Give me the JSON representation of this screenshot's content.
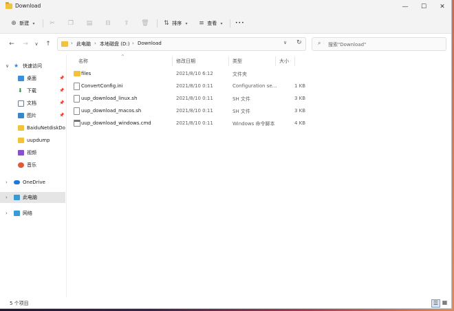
{
  "window": {
    "title": "Download"
  },
  "titlebar": {
    "minimize": "—",
    "maximize": "☐",
    "close": "✕"
  },
  "toolbar": {
    "new_label": "新建",
    "sort_label": "排序",
    "view_label": "查看",
    "more_label": "•••",
    "icons": [
      "cut-icon",
      "copy-icon",
      "paste-icon",
      "rename-icon",
      "share-icon",
      "delete-icon"
    ]
  },
  "address": {
    "crumbs": [
      "此电脑",
      "本地磁盘 (D:)",
      "Download"
    ],
    "search_placeholder": "搜索\"Download\""
  },
  "sidebar": {
    "items": [
      {
        "label": "快速访问",
        "icon": "star-icon",
        "color": "#3b7dd8"
      },
      {
        "label": "桌面",
        "icon": "desktop-icon",
        "color": "#3b8fd8"
      },
      {
        "label": "下载",
        "icon": "download-icon",
        "color": "#2a8a4a"
      },
      {
        "label": "文档",
        "icon": "document-icon",
        "color": "#6b7b8c"
      },
      {
        "label": "图片",
        "icon": "pictures-icon",
        "color": "#3a86c8"
      },
      {
        "label": "BaiduNetdiskDownload",
        "icon": "folder-icon",
        "color": "#f3c23d"
      },
      {
        "label": "uupdump",
        "icon": "folder-icon",
        "color": "#f3c23d"
      },
      {
        "label": "视频",
        "icon": "videos-icon",
        "color": "#8a4fd0"
      },
      {
        "label": "音乐",
        "icon": "music-icon",
        "color": "#e05a3a"
      },
      {
        "label": "OneDrive",
        "icon": "cloud-icon",
        "color": "#1f77d8"
      },
      {
        "label": "此电脑",
        "icon": "computer-icon",
        "color": "#3a9ad8"
      },
      {
        "label": "网络",
        "icon": "network-icon",
        "color": "#3a9ad8"
      }
    ]
  },
  "columns": {
    "name": "名称",
    "date": "修改日期",
    "type": "类型",
    "size": "大小"
  },
  "files": [
    {
      "name": "files",
      "date": "2021/8/10 6:12",
      "type": "文件夹",
      "size": "",
      "kind": "folder"
    },
    {
      "name": "ConvertConfig.ini",
      "date": "2021/8/10 0:11",
      "type": "Configuration se...",
      "size": "1 KB",
      "kind": "doc"
    },
    {
      "name": "uup_download_linux.sh",
      "date": "2021/8/10 0:11",
      "type": "SH 文件",
      "size": "3 KB",
      "kind": "doc"
    },
    {
      "name": "uup_download_macos.sh",
      "date": "2021/8/10 0:11",
      "type": "SH 文件",
      "size": "3 KB",
      "kind": "doc"
    },
    {
      "name": "uup_download_windows.cmd",
      "date": "2021/8/10 0:11",
      "type": "Windows 命令脚本",
      "size": "4 KB",
      "kind": "cmd"
    }
  ],
  "status": {
    "count": "5 个项目"
  }
}
